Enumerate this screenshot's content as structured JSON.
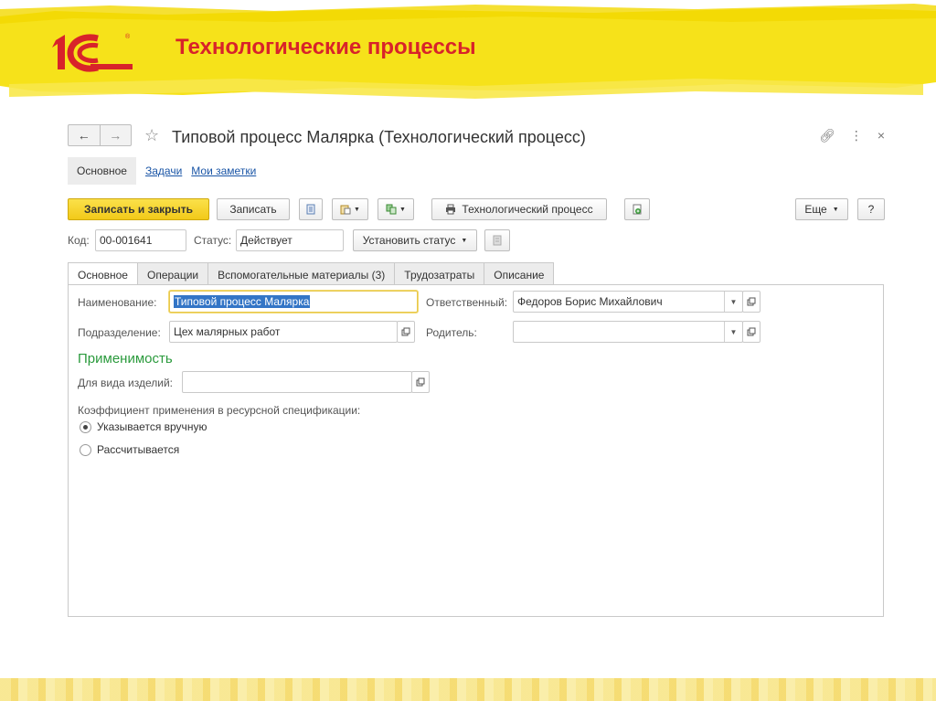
{
  "slide": {
    "title": "Технологические процессы",
    "logo_text": "1С",
    "accent_color": "#d8232a",
    "brush_color": "#f5e000"
  },
  "window": {
    "title": "Типовой процесс Малярка (Технологический процесс)",
    "nav_back_icon": "arrow-left-icon",
    "nav_forward_icon": "arrow-right-icon",
    "favorite_icon": "star-icon",
    "controls": [
      "link-icon",
      "more-vertical-icon",
      "close-icon"
    ]
  },
  "subnav": {
    "main": "Основное",
    "tasks": "Задачи",
    "notes": "Мои заметки"
  },
  "toolbar": {
    "save_close": "Записать и закрыть",
    "save": "Записать",
    "print": "Технологический процесс",
    "more": "Еще",
    "help": "?"
  },
  "header_fields": {
    "code_label": "Код:",
    "code_value": "00-001641",
    "status_label": "Статус:",
    "status_value": "Действует",
    "set_status": "Установить статус"
  },
  "tabs": [
    "Основное",
    "Операции",
    "Вспомогательные материалы (3)",
    "Трудозатраты",
    "Описание"
  ],
  "form": {
    "name_label": "Наименование:",
    "name_value": "Типовой процесс Малярка",
    "responsible_label": "Ответственный:",
    "responsible_value": "Федоров Борис Михайлович",
    "division_label": "Подразделение:",
    "division_value": "Цех малярных работ",
    "parent_label": "Родитель:",
    "parent_value": "",
    "section_title": "Применимость",
    "product_kind_label": "Для вида изделий:",
    "product_kind_value": "",
    "coef_label": "Коэффициент применения в ресурсной спецификации:",
    "radio_manual": "Указывается вручную",
    "radio_calc": "Рассчитывается",
    "radio_selected": "manual"
  }
}
